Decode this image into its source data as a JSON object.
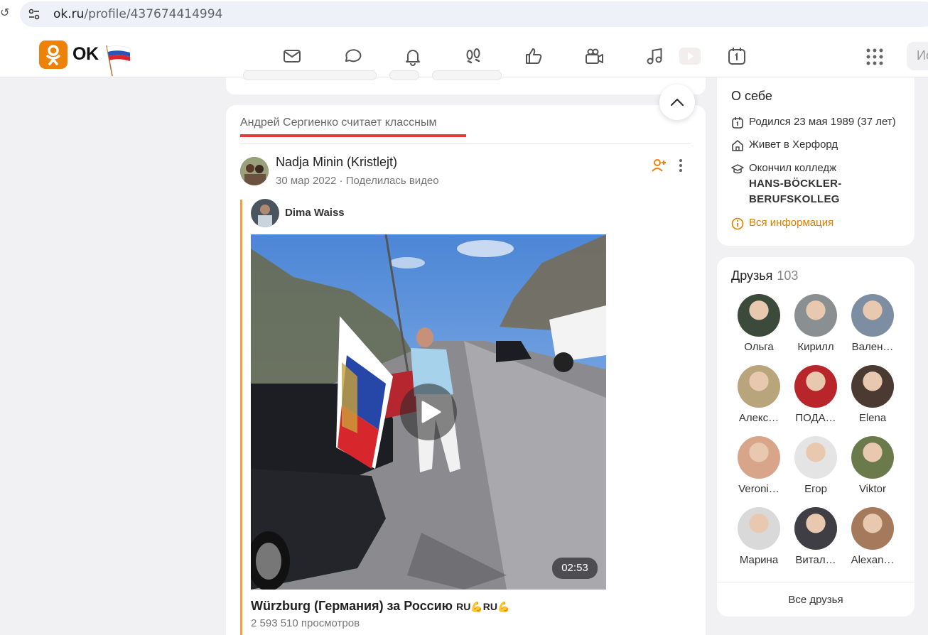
{
  "browser": {
    "url_host": "ok.ru",
    "url_path": "/profile/437674414994"
  },
  "header": {
    "logo_text": "OK",
    "nav_icons": [
      "mail-icon",
      "chat-icon",
      "bell-icon",
      "footprints-icon",
      "thumbs-up-icon",
      "video-camera-icon",
      "music-icon",
      "video-icon",
      "calendar-icon"
    ],
    "search_placeholder": "Ис"
  },
  "feed": {
    "liked_by": "Андрей Сергиенко считает классным",
    "post": {
      "author": "Nadja Minin (Kristlejt)",
      "date": "30 мар 2022",
      "action": "Поделилась видео",
      "original_author": "Dima Waiss",
      "video_duration": "02:53",
      "video_title": "Würzburg (Германия) за Россию",
      "video_title_suffix": "RU💪RU💪",
      "views": "2 593 510 просмотров"
    }
  },
  "about": {
    "title": "О себе",
    "born": "Родился 23 мая 1989 (37 лет)",
    "lives": "Живет в Херфорд",
    "education_prefix": "Окончил колледж",
    "education_name_1": "HANS-BÖCKLER-",
    "education_name_2": "BERUFSKOLLEG",
    "all_info": "Вся информация"
  },
  "friends": {
    "title": "Друзья",
    "count": "103",
    "items": [
      {
        "name": "Ольга",
        "color": "#3b4a3a"
      },
      {
        "name": "Кирилл",
        "color": "#8a8f92"
      },
      {
        "name": "Вален…",
        "color": "#7d8ea3"
      },
      {
        "name": "Алекс…",
        "color": "#b9a57c"
      },
      {
        "name": "ПОДА…",
        "color": "#b8262b"
      },
      {
        "name": "Elena",
        "color": "#4a3a32"
      },
      {
        "name": "Veroni…",
        "color": "#d8a48a"
      },
      {
        "name": "Егор",
        "color": "#e4e4e4"
      },
      {
        "name": "Viktor",
        "color": "#6b7a4a"
      },
      {
        "name": "Марина",
        "color": "#d9d9d9"
      },
      {
        "name": "Витал…",
        "color": "#3e3e44"
      },
      {
        "name": "Alexan…",
        "color": "#a57a5c"
      }
    ],
    "all_friends": "Все друзья"
  },
  "colors": {
    "accent": "#ee8208",
    "liked_underline": "#e8383f",
    "link": "#e07c00"
  }
}
